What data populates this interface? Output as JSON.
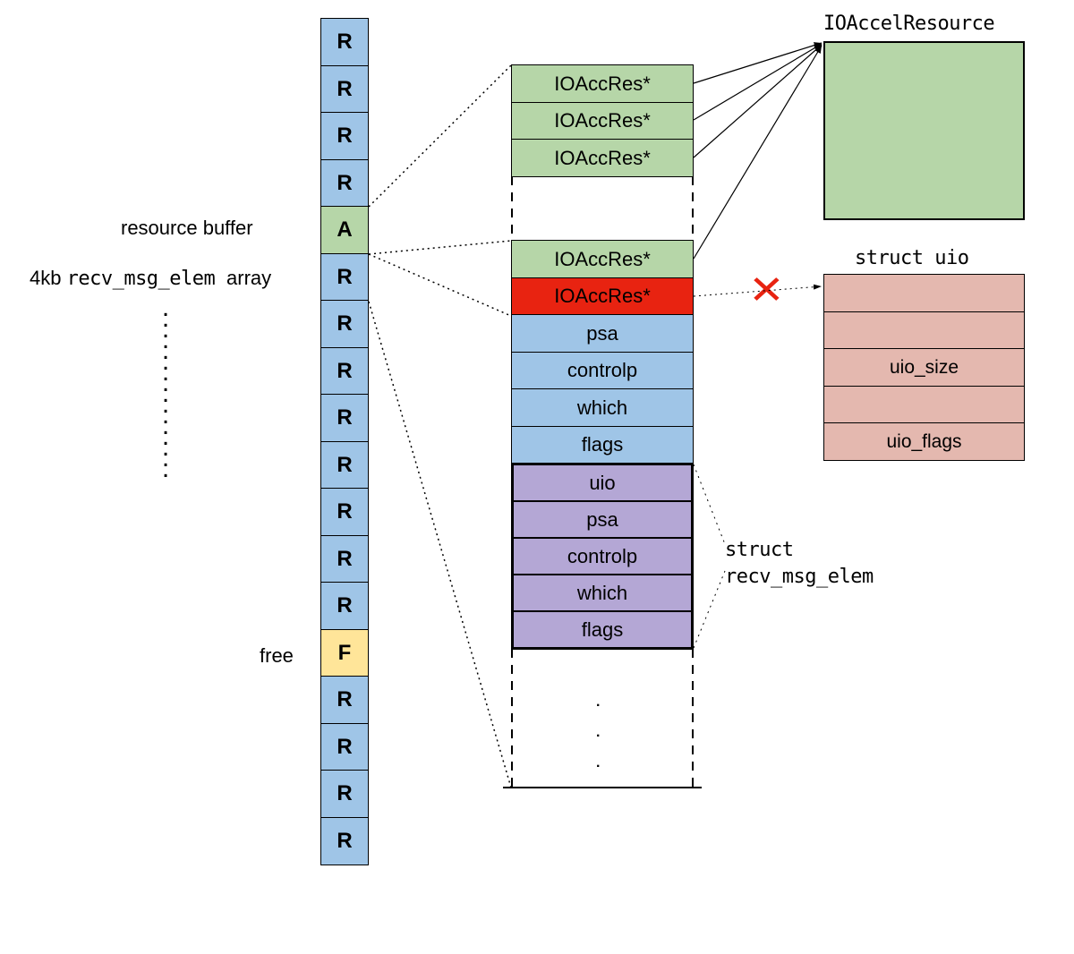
{
  "leftColumn": {
    "cells": [
      {
        "t": "R",
        "c": "blue"
      },
      {
        "t": "R",
        "c": "blue"
      },
      {
        "t": "R",
        "c": "blue"
      },
      {
        "t": "R",
        "c": "blue"
      },
      {
        "t": "A",
        "c": "green"
      },
      {
        "t": "R",
        "c": "blue"
      },
      {
        "t": "R",
        "c": "blue"
      },
      {
        "t": "R",
        "c": "blue"
      },
      {
        "t": "R",
        "c": "blue"
      },
      {
        "t": "R",
        "c": "blue"
      },
      {
        "t": "R",
        "c": "blue"
      },
      {
        "t": "R",
        "c": "blue"
      },
      {
        "t": "R",
        "c": "blue"
      },
      {
        "t": "F",
        "c": "yellow"
      },
      {
        "t": "R",
        "c": "blue"
      },
      {
        "t": "R",
        "c": "blue"
      },
      {
        "t": "R",
        "c": "blue"
      },
      {
        "t": "R",
        "c": "blue"
      }
    ]
  },
  "labels": {
    "resourceBuffer": "resource buffer",
    "recvArray1": "4kb ",
    "recvArray2": "recv_msg_elem ",
    "recvArray3": "array",
    "free": "free",
    "ioaccel": "IOAccelResource",
    "structUio": "struct uio",
    "structRecv1": "struct",
    "structRecv2": "recv_msg_elem"
  },
  "midTop": [
    "IOAccRes*",
    "IOAccRes*",
    "IOAccRes*"
  ],
  "midBridge": [
    {
      "t": "IOAccRes*",
      "c": "green"
    },
    {
      "t": "IOAccRes*",
      "c": "red"
    }
  ],
  "midBlue": [
    "psa",
    "controlp",
    "which",
    "flags"
  ],
  "midPurple": [
    "uio",
    "psa",
    "controlp",
    "which",
    "flags"
  ],
  "pinkFields": {
    "row2": "uio_size",
    "row4": "uio_flags"
  }
}
